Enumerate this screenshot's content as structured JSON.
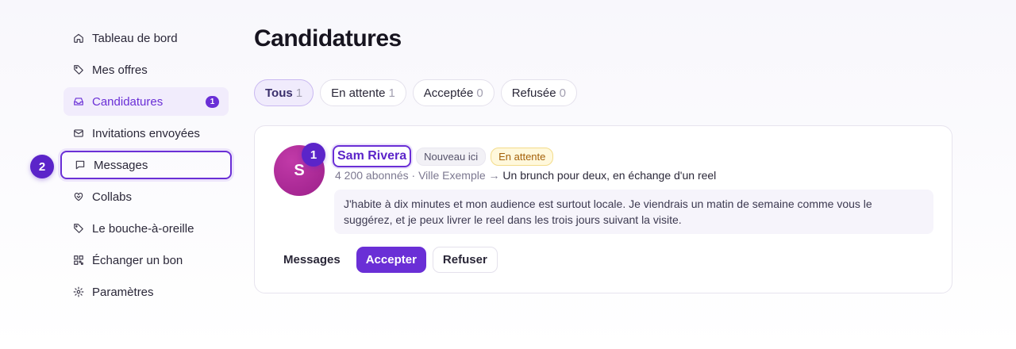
{
  "sidebar": {
    "items": [
      {
        "label": "Tableau de bord",
        "icon": "home-icon"
      },
      {
        "label": "Mes offres",
        "icon": "tag-icon"
      },
      {
        "label": "Candidatures",
        "icon": "inbox-icon",
        "badge": "1"
      },
      {
        "label": "Invitations envoyées",
        "icon": "mail-icon"
      },
      {
        "label": "Messages",
        "icon": "message-icon"
      },
      {
        "label": "Collabs",
        "icon": "handshake-icon"
      },
      {
        "label": "Le bouche-à-oreille",
        "icon": "tag-icon"
      },
      {
        "label": "Échanger un bon",
        "icon": "qr-icon"
      },
      {
        "label": "Paramètres",
        "icon": "gear-icon"
      }
    ]
  },
  "markers": {
    "one": "1",
    "two": "2"
  },
  "page": {
    "title": "Candidatures"
  },
  "tabs": [
    {
      "label": "Tous",
      "count": "1"
    },
    {
      "label": "En attente",
      "count": "1"
    },
    {
      "label": "Acceptée",
      "count": "0"
    },
    {
      "label": "Refusée",
      "count": "0"
    }
  ],
  "application": {
    "avatar_initial": "S",
    "name": "Sam Rivera",
    "tag_new": "Nouveau ici",
    "status": "En attente",
    "meta_prefix": "4 200 abonnés · Ville Exemple → ",
    "offer": "Un brunch pour deux, en échange d'un reel",
    "message": "J'habite à dix minutes et mon audience est surtout locale. Je viendrais un matin de semaine comme vous le suggérez, et je peux livrer le reel dans les trois jours suivant la visite.",
    "actions": {
      "messages": "Messages",
      "accept": "Accepter",
      "refuse": "Refuser"
    }
  },
  "colors": {
    "accent": "#6a2fd6",
    "pending_bg": "#fff8dc",
    "pending_text": "#a4600a"
  }
}
